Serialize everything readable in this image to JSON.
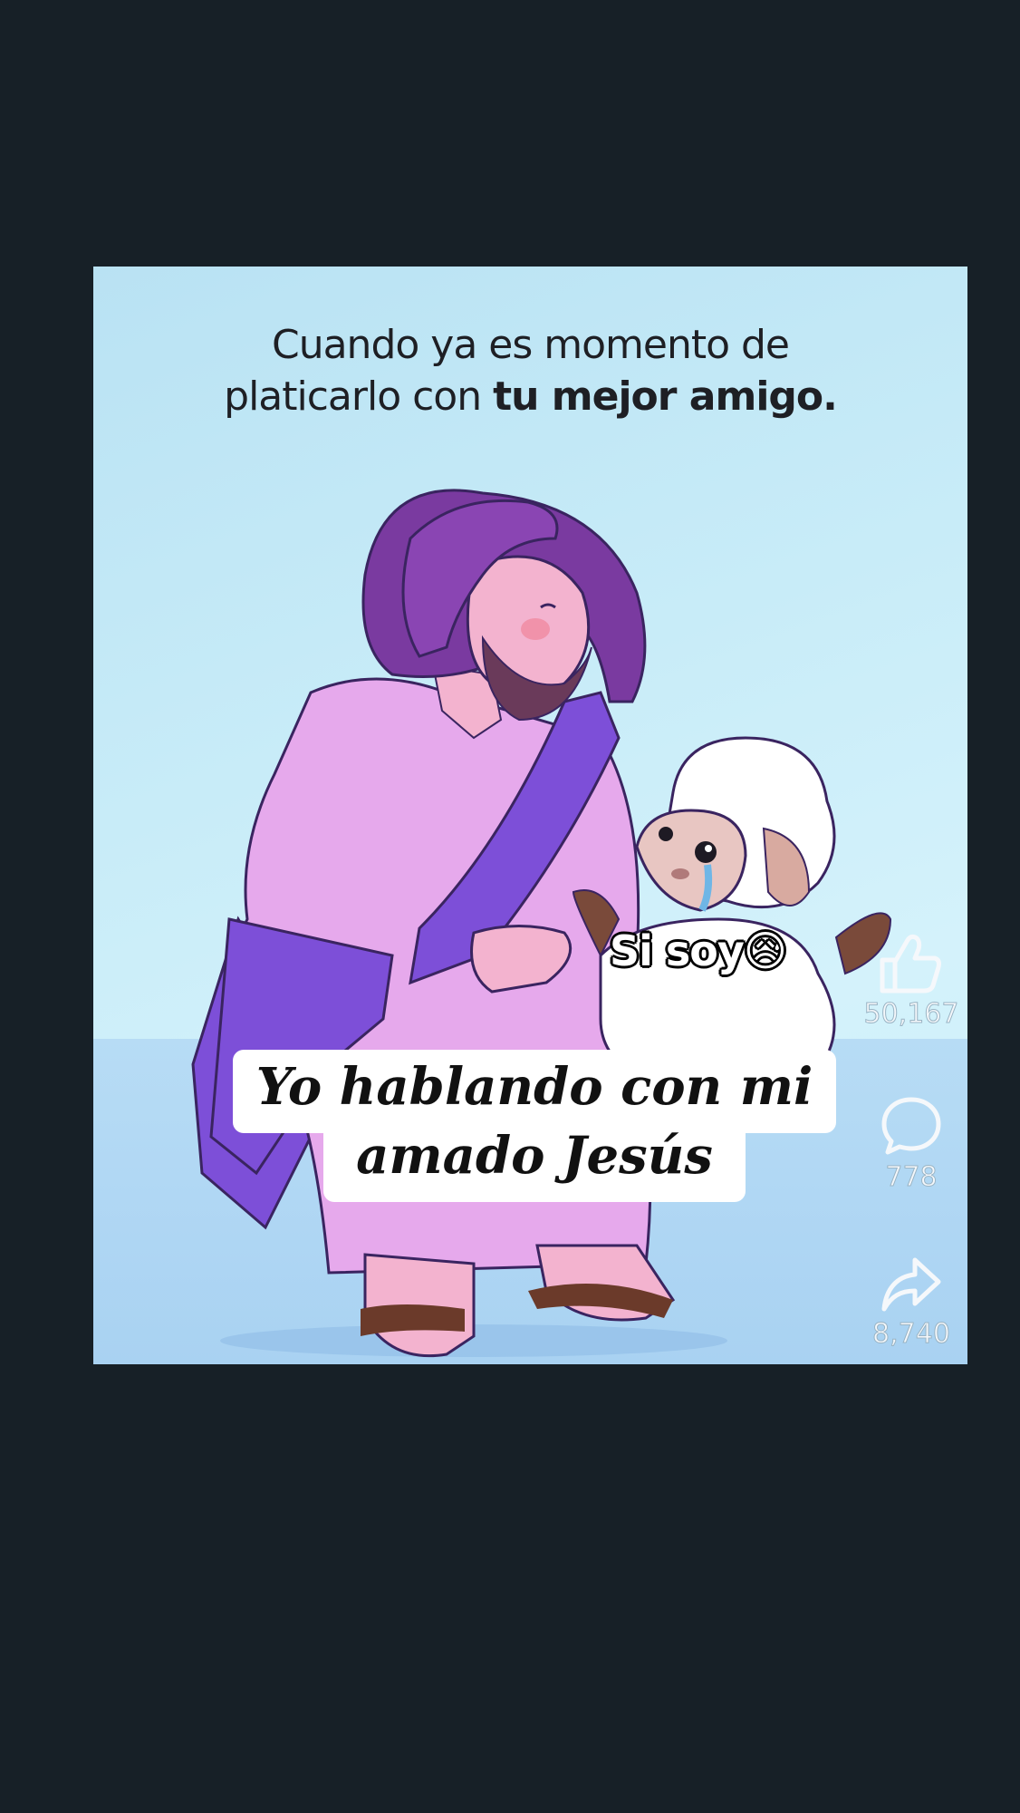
{
  "post": {
    "caption_line1": "Cuando ya es momento de",
    "caption_line2_start": "platicarlo con ",
    "caption_line2_bold": "tu mejor amigo.",
    "overlay_line1": "Yo hablando con mi",
    "overlay_line2": "amado Jesús",
    "sticker_text": "Si soy😥"
  },
  "actions": {
    "like_count": "50,167",
    "comment_count": "778",
    "share_count": "8,740",
    "like_icon": "thumbs-up-icon",
    "comment_icon": "comment-bubble-icon",
    "share_icon": "share-arrow-icon"
  },
  "colors": {
    "page_background": "#172027",
    "sky": "#c8ecf8",
    "floor": "#a9d2f2",
    "robe": "#e6a9ec",
    "sash": "#7d4fd8",
    "hair": "#7a3aa0"
  }
}
